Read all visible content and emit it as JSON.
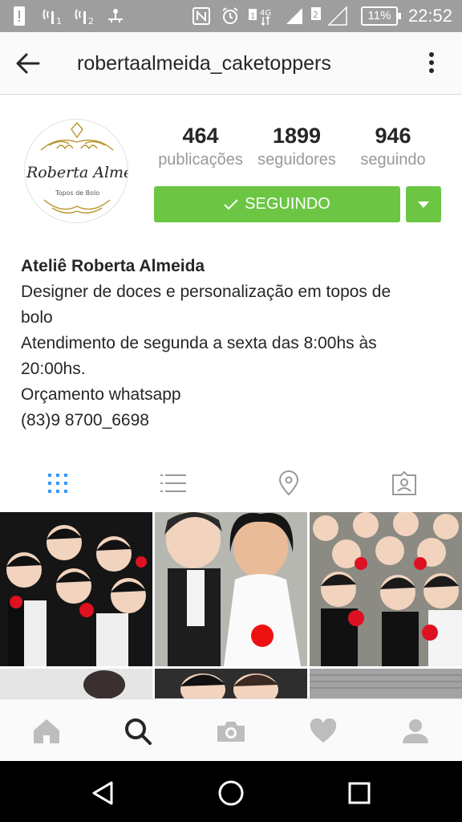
{
  "status_bar": {
    "time": "22:52",
    "battery": "11%",
    "icons": [
      "alert-icon",
      "sim1-signal-icon",
      "sim2-signal-icon",
      "usb-icon",
      "nfc-icon",
      "alarm-icon",
      "4g-icon",
      "signal-1-icon",
      "signal-2-icon"
    ]
  },
  "header": {
    "username": "robertaalmeida_caketoppers"
  },
  "profile": {
    "avatar_logo_text": "Roberta Alme",
    "avatar_logo_subtext": "Topos de Bolo",
    "stats": [
      {
        "value": "464",
        "label": "publicações"
      },
      {
        "value": "1899",
        "label": "seguidores"
      },
      {
        "value": "946",
        "label": "seguindo"
      }
    ],
    "follow_label": "SEGUINDO"
  },
  "bio": {
    "name": "Ateliê Roberta Almeida",
    "lines": [
      "Designer de doces e personalização em topos de",
      "bolo",
      "Atendimento de segunda a sexta das 8:00hs às",
      "20:00hs.",
      "Orçamento whatsapp",
      "(83)9 8700_6698"
    ]
  },
  "tabs": [
    "grid-view-icon",
    "list-view-icon",
    "location-icon",
    "tagged-icon"
  ],
  "bottom_nav": [
    "home-icon",
    "search-icon",
    "camera-icon",
    "heart-icon",
    "profile-icon"
  ],
  "colors": {
    "accent_green": "#6cc644",
    "active_tab_blue": "#3897f0",
    "status_bar": "#9e9e9e"
  }
}
